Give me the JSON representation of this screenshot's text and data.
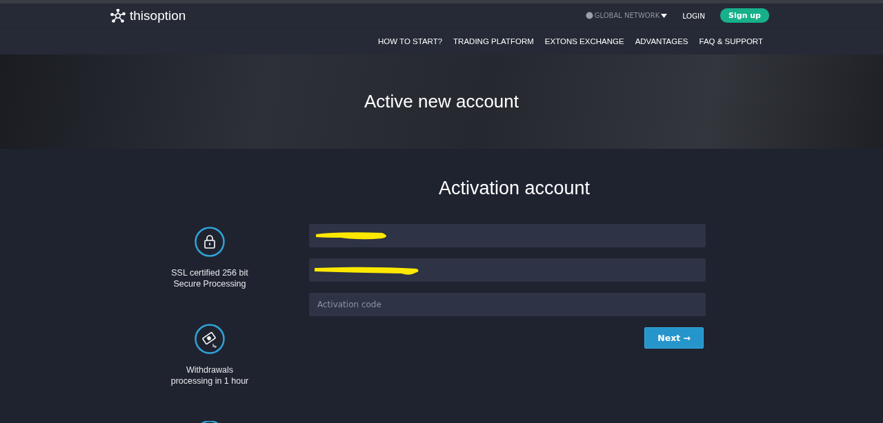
{
  "header": {
    "logo": "thisoption",
    "network": "GLOBAL NETWORK",
    "login": "LOGIN",
    "signup": "Sign up"
  },
  "nav": [
    {
      "label": "HOW TO START?"
    },
    {
      "label": "TRADING PLATFORM"
    },
    {
      "label": "EXTONS EXCHANGE"
    },
    {
      "label": "ADVANTAGES"
    },
    {
      "label": "FAQ & SUPPORT"
    }
  ],
  "hero": {
    "title": "Active new account"
  },
  "form": {
    "title": "Activation account",
    "fields": [
      {
        "kind": "redacted"
      },
      {
        "kind": "redacted"
      },
      {
        "kind": "input",
        "placeholder": "Activation code"
      }
    ],
    "button": "Next →"
  },
  "features": [
    {
      "kind": "lock",
      "lines": [
        "SSL certified 256 bit",
        "Secure Processing"
      ]
    },
    {
      "kind": "money",
      "lines": [
        "Withdrawals",
        "processing in 1 hour"
      ]
    },
    {
      "kind": "partial"
    }
  ]
}
